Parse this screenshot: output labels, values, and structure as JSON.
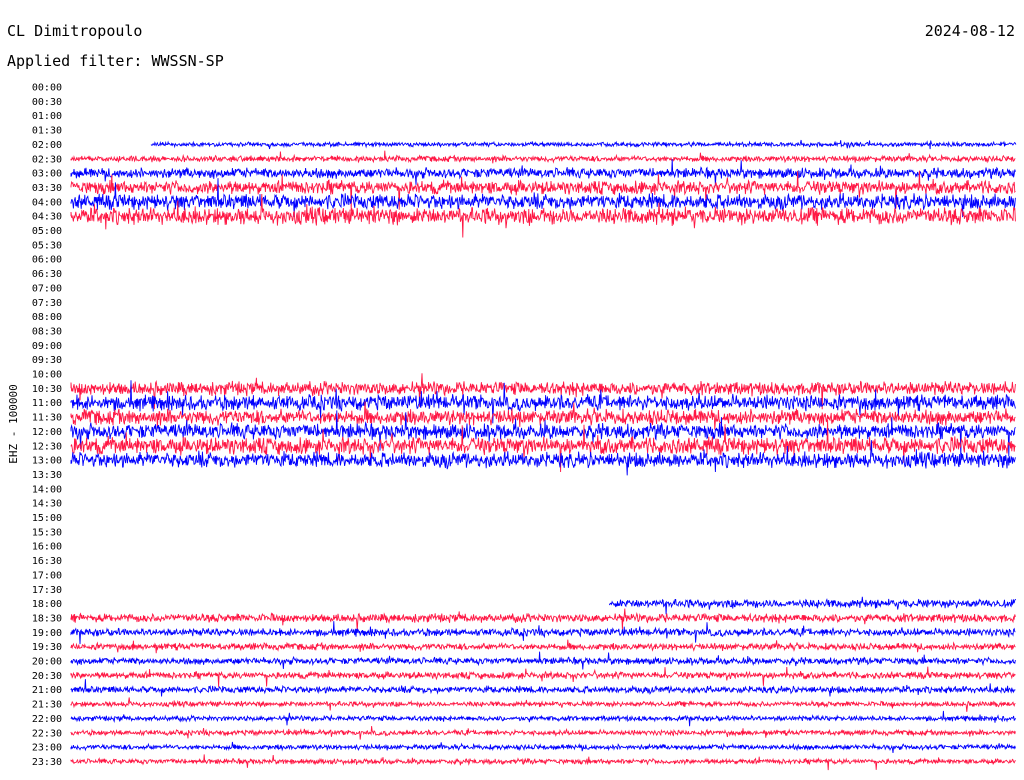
{
  "header": {
    "station": "CL Dimitropoulo",
    "date": "2024-08-12",
    "filter": "Applied filter: WWSSN-SP"
  },
  "chart_data": {
    "type": "line",
    "title": "CL Dimitropoulo",
    "ylabel": "EHZ - 100000",
    "colors": {
      "odd_trace": "#ff1744",
      "even_trace": "#0000ff"
    },
    "time_labels": [
      "00:00",
      "00:30",
      "01:00",
      "01:30",
      "02:00",
      "02:30",
      "03:00",
      "03:30",
      "04:00",
      "04:30",
      "05:00",
      "05:30",
      "06:00",
      "06:30",
      "07:00",
      "07:30",
      "08:00",
      "08:30",
      "09:00",
      "09:30",
      "10:00",
      "10:30",
      "11:00",
      "11:30",
      "12:00",
      "12:30",
      "13:00",
      "13:30",
      "14:00",
      "14:30",
      "15:00",
      "15:30",
      "16:00",
      "16:30",
      "17:00",
      "17:30",
      "18:00",
      "18:30",
      "19:00",
      "19:30",
      "20:00",
      "20:30",
      "21:00",
      "21:30",
      "22:00",
      "22:30",
      "23:00",
      "23:30"
    ],
    "series": [
      {
        "label": "02:00",
        "start": 0.085,
        "amp": 2.5
      },
      {
        "label": "02:30",
        "start": 0.0,
        "amp": 3.5
      },
      {
        "label": "03:00",
        "start": 0.0,
        "amp": 6
      },
      {
        "label": "03:30",
        "start": 0.0,
        "amp": 8
      },
      {
        "label": "04:00",
        "start": 0.0,
        "amp": 9
      },
      {
        "label": "04:30",
        "start": 0.0,
        "amp": 10
      },
      {
        "label": "10:30",
        "start": 0.0,
        "amp": 8
      },
      {
        "label": "11:00",
        "start": 0.0,
        "amp": 9
      },
      {
        "label": "11:30",
        "start": 0.0,
        "amp": 9
      },
      {
        "label": "12:00",
        "start": 0.0,
        "amp": 9
      },
      {
        "label": "12:30",
        "start": 0.0,
        "amp": 10
      },
      {
        "label": "13:00",
        "start": 0.0,
        "amp": 9
      },
      {
        "label": "18:00",
        "start": 0.57,
        "amp": 5
      },
      {
        "label": "18:30",
        "start": 0.0,
        "amp": 5
      },
      {
        "label": "19:00",
        "start": 0.0,
        "amp": 4.5
      },
      {
        "label": "19:30",
        "start": 0.0,
        "amp": 4
      },
      {
        "label": "20:00",
        "start": 0.0,
        "amp": 4
      },
      {
        "label": "20:30",
        "start": 0.0,
        "amp": 4
      },
      {
        "label": "21:00",
        "start": 0.0,
        "amp": 4
      },
      {
        "label": "21:30",
        "start": 0.0,
        "amp": 3
      },
      {
        "label": "22:00",
        "start": 0.0,
        "amp": 3
      },
      {
        "label": "22:30",
        "start": 0.0,
        "amp": 3
      },
      {
        "label": "23:00",
        "start": 0.0,
        "amp": 3
      },
      {
        "label": "23:30",
        "start": 0.0,
        "amp": 3
      }
    ]
  }
}
